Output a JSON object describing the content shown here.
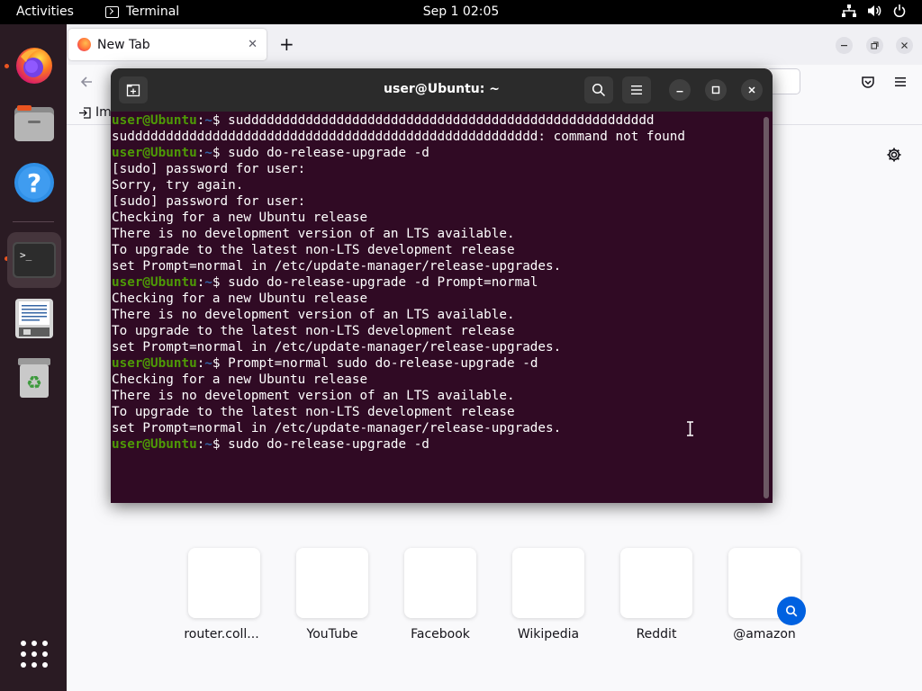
{
  "topbar": {
    "activities": "Activities",
    "app_name": "Terminal",
    "clock": "Sep 1  02:05",
    "tray_icons": [
      "network-icon",
      "volume-icon",
      "power-icon"
    ]
  },
  "dock": {
    "items": [
      {
        "name": "Firefox",
        "icon": "firefox-icon",
        "running": true
      },
      {
        "name": "Files",
        "icon": "files-icon",
        "running": false
      },
      {
        "name": "Help",
        "icon": "help-icon",
        "running": false
      },
      {
        "name": "Terminal",
        "icon": "terminal-icon",
        "running": true,
        "active": true
      },
      {
        "name": "Text Editor",
        "icon": "text-editor-icon",
        "running": false
      },
      {
        "name": "Trash",
        "icon": "trash-icon",
        "running": false
      }
    ],
    "apps_grid_icon": "show-apps-icon"
  },
  "firefox": {
    "tab": {
      "label": "New Tab",
      "close": "✕"
    },
    "new_tab": "+",
    "bookmark_import_label": "Im",
    "top_sites": [
      "router.coll...",
      "YouTube",
      "Facebook",
      "Wikipedia",
      "Reddit",
      "@amazon"
    ]
  },
  "terminal": {
    "title": "user@Ubuntu: ~",
    "prompt": {
      "user": "user@Ubuntu",
      "colon": ":",
      "path": "~",
      "symbol": "$ "
    },
    "lines": [
      {
        "prompt": true,
        "text": "suddddddddddddddddddddddddddddddddddddddddddddddddddddd"
      },
      {
        "prompt": false,
        "text": "suddddddddddddddddddddddddddddddddddddddddddddddddddddd: command not found"
      },
      {
        "prompt": true,
        "text": "sudo do-release-upgrade -d"
      },
      {
        "prompt": false,
        "text": "[sudo] password for user:"
      },
      {
        "prompt": false,
        "text": "Sorry, try again."
      },
      {
        "prompt": false,
        "text": "[sudo] password for user:"
      },
      {
        "prompt": false,
        "text": "Checking for a new Ubuntu release"
      },
      {
        "prompt": false,
        "text": "There is no development version of an LTS available."
      },
      {
        "prompt": false,
        "text": "To upgrade to the latest non-LTS development release"
      },
      {
        "prompt": false,
        "text": "set Prompt=normal in /etc/update-manager/release-upgrades."
      },
      {
        "prompt": true,
        "text": "sudo do-release-upgrade -d Prompt=normal"
      },
      {
        "prompt": false,
        "text": "Checking for a new Ubuntu release"
      },
      {
        "prompt": false,
        "text": "There is no development version of an LTS available."
      },
      {
        "prompt": false,
        "text": "To upgrade to the latest non-LTS development release"
      },
      {
        "prompt": false,
        "text": "set Prompt=normal in /etc/update-manager/release-upgrades."
      },
      {
        "prompt": true,
        "text": "Prompt=normal sudo do-release-upgrade -d"
      },
      {
        "prompt": false,
        "text": "Checking for a new Ubuntu release"
      },
      {
        "prompt": false,
        "text": "There is no development version of an LTS available."
      },
      {
        "prompt": false,
        "text": "To upgrade to the latest non-LTS development release"
      },
      {
        "prompt": false,
        "text": "set Prompt=normal in /etc/update-manager/release-upgrades."
      },
      {
        "prompt": true,
        "text": "sudo do-release-upgrade -d"
      }
    ]
  },
  "colors": {
    "terminal_bg": "#300a24",
    "prompt_user": "#4e9a06",
    "prompt_path": "#3465a4",
    "ubuntu_orange": "#e95420",
    "dock_bg": "#2a1b23"
  }
}
